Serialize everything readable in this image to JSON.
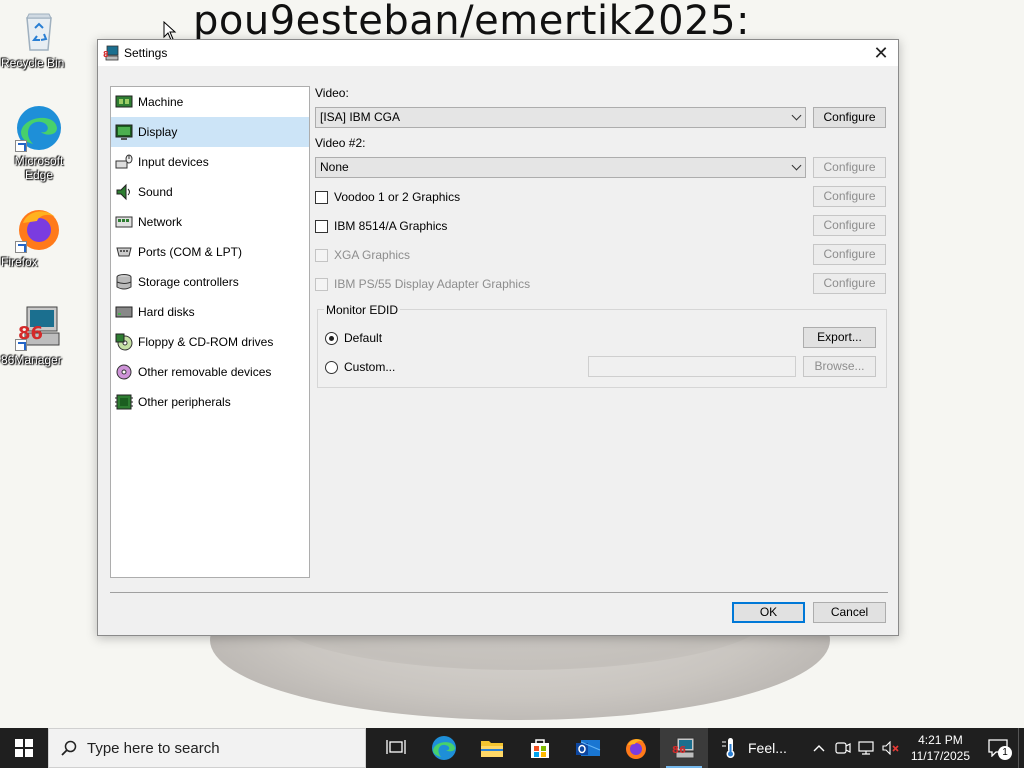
{
  "wallpaper": {
    "text": "pou9esteban/emertik2025:"
  },
  "desktop_icons": [
    {
      "label": "Recycle Bin"
    },
    {
      "label": "Microsoft Edge"
    },
    {
      "label": "Firefox"
    },
    {
      "label": "86Manager"
    }
  ],
  "window": {
    "title": "Settings",
    "close_symbol": "✕",
    "sidebar": [
      {
        "label": "Machine",
        "icon": "machine-icon"
      },
      {
        "label": "Display",
        "icon": "display-icon",
        "selected": true
      },
      {
        "label": "Input devices",
        "icon": "input-devices-icon"
      },
      {
        "label": "Sound",
        "icon": "sound-icon"
      },
      {
        "label": "Network",
        "icon": "network-icon"
      },
      {
        "label": "Ports (COM & LPT)",
        "icon": "ports-icon"
      },
      {
        "label": "Storage controllers",
        "icon": "storage-icon"
      },
      {
        "label": "Hard disks",
        "icon": "hard-disk-icon"
      },
      {
        "label": "Floppy & CD-ROM drives",
        "icon": "floppy-cdrom-icon"
      },
      {
        "label": "Other removable devices",
        "icon": "removable-icon"
      },
      {
        "label": "Other peripherals",
        "icon": "peripherals-icon"
      }
    ],
    "display": {
      "video_label": "Video:",
      "video_value": "[ISA] IBM CGA",
      "video_configure": "Configure",
      "video2_label": "Video #2:",
      "video2_value": "None",
      "video2_configure": "Configure",
      "checkboxes": [
        {
          "label": "Voodoo 1 or 2 Graphics",
          "configure": "Configure",
          "enabled": true,
          "checked": false
        },
        {
          "label": "IBM 8514/A Graphics",
          "configure": "Configure",
          "enabled": true,
          "checked": false
        },
        {
          "label": "XGA Graphics",
          "configure": "Configure",
          "enabled": false,
          "checked": false
        },
        {
          "label": "IBM PS/55 Display Adapter Graphics",
          "configure": "Configure",
          "enabled": false,
          "checked": false
        }
      ],
      "monitor_edid": {
        "title": "Monitor EDID",
        "default_label": "Default",
        "custom_label": "Custom...",
        "export_label": "Export...",
        "browse_label": "Browse...",
        "selected": "Default"
      }
    },
    "ok_label": "OK",
    "cancel_label": "Cancel"
  },
  "taskbar": {
    "search_placeholder": "Type here to search",
    "weather_text": "Feel...",
    "time": "4:21 PM",
    "date": "11/17/2025",
    "notification_count": "1"
  },
  "colors": {
    "selection": "#cce4f7",
    "taskbar": "#1f1f1f",
    "accent": "#0078d7"
  }
}
